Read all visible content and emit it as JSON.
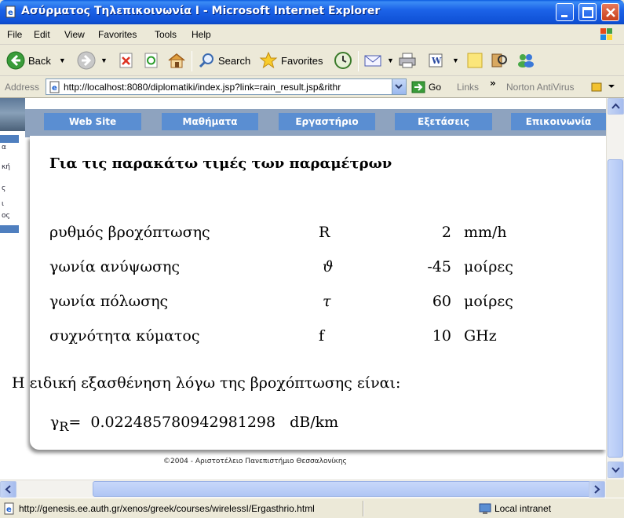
{
  "window": {
    "title": "Ασύρματος Τηλεπικοινωνία Ι - Microsoft Internet Explorer"
  },
  "menu": [
    "File",
    "Edit",
    "View",
    "Favorites",
    "Tools",
    "Help"
  ],
  "toolbar": {
    "back_label": "Back",
    "search_label": "Search",
    "favorites_label": "Favorites"
  },
  "address": {
    "label": "Address",
    "url": "http://localhost:8080/diplomatiki/index.jsp?link=rain_result.jsp&rithr",
    "go_label": "Go",
    "links_label": "Links",
    "chevron": "»",
    "norton_label": "Norton AntiVirus"
  },
  "sidebar_fragments": [
    "α",
    "κή",
    "ς",
    "ι",
    "ος"
  ],
  "nav": [
    "Web Site",
    "Μαθήματα",
    "Εργαστήριο",
    "Εξετάσεις",
    "Επικοινωνία"
  ],
  "content": {
    "heading": "Για τις παρακάτω τιμές των παραμέτρων",
    "parameters": [
      {
        "name": "ρυθμός βροχόπτωσης",
        "symbol": "R",
        "value": "2",
        "unit": "mm/h"
      },
      {
        "name": "γωνία ανύψωσης",
        "symbol": "ϑ",
        "value": "-45",
        "unit": "μοίρες"
      },
      {
        "name": "γωνία πόλωσης",
        "symbol": "τ",
        "value": "60",
        "unit": "μοίρες"
      },
      {
        "name": "συχνότητα κύματος",
        "symbol": "f",
        "value": "10",
        "unit": "GHz"
      }
    ],
    "result_text": "Η ειδική εξασθένηση λόγω της βροχόπτωσης είναι:",
    "result_symbol": "γ",
    "result_subscript": "R",
    "result_equals": "=",
    "result_value": "0.022485780942981298",
    "result_unit": "dB/km"
  },
  "footer": "©2004 - Αριστοτέλειο Πανεπιστήμιο Θεσσαλονίκης",
  "status": {
    "url": "http://genesis.ee.auth.gr/xenos/greek/courses/wirelessI/Ergasthrio.html",
    "zone": "Local intranet"
  }
}
